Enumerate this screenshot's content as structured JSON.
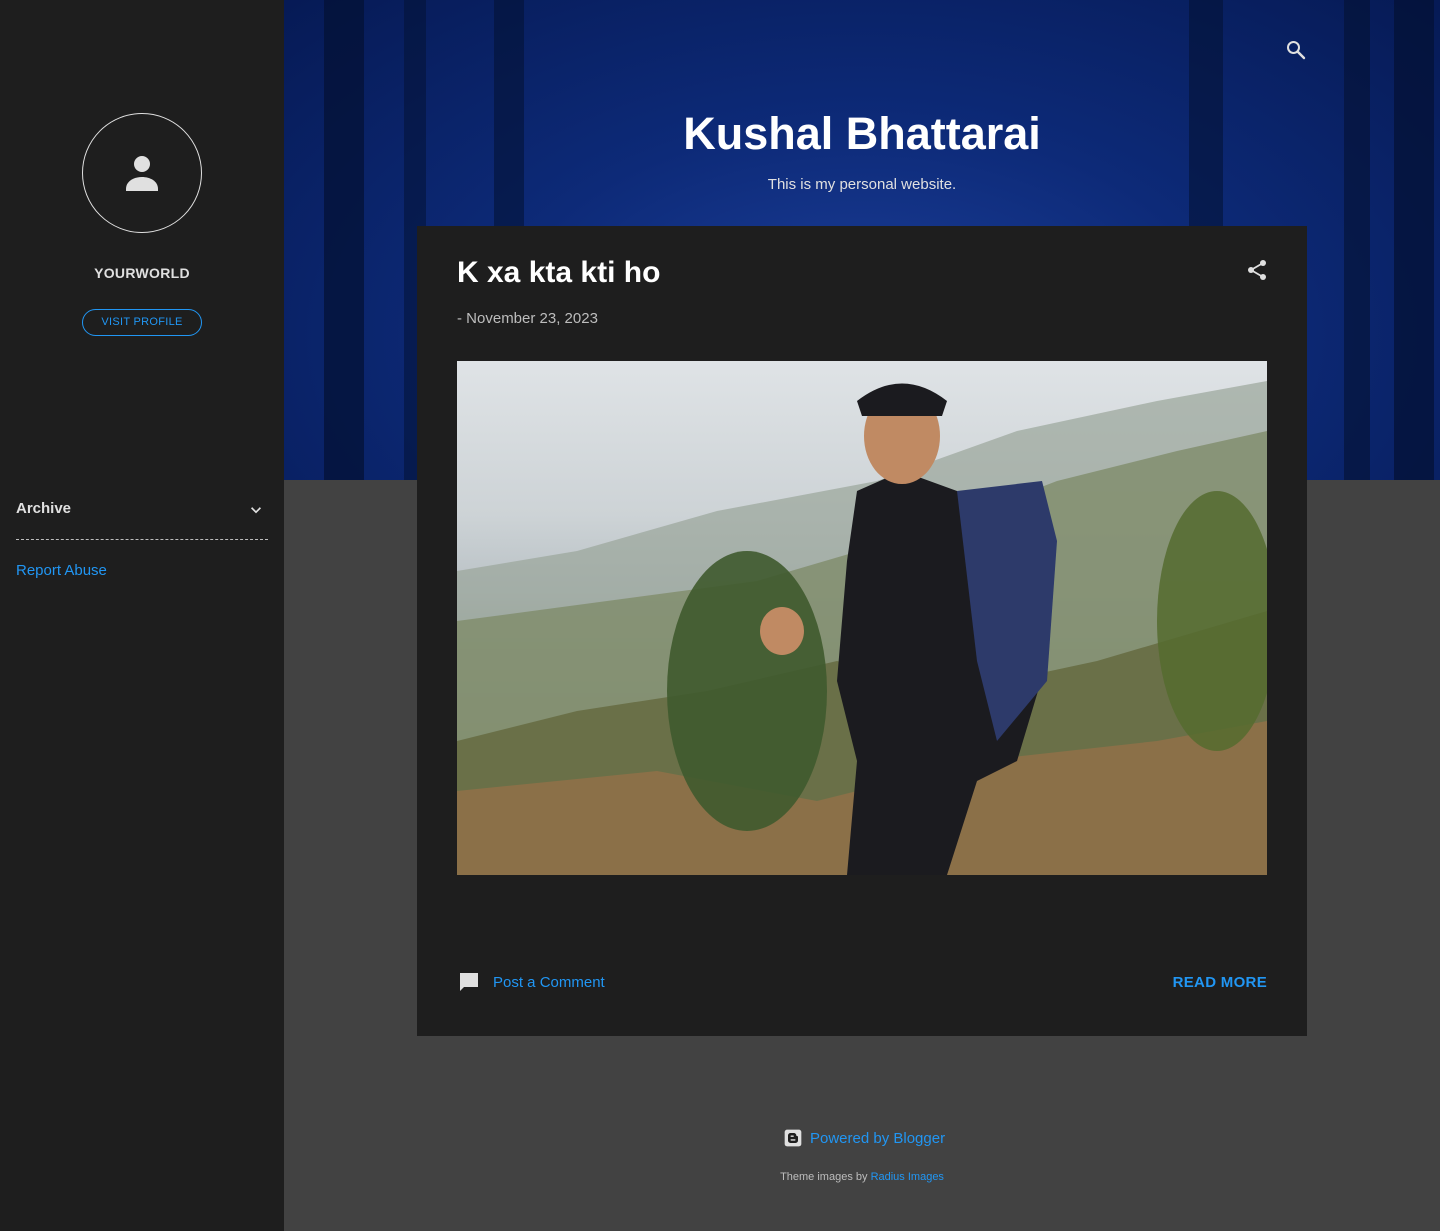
{
  "sidebar": {
    "profile_name": "YOURWORLD",
    "visit_profile_label": "VISIT PROFILE",
    "archive_label": "Archive",
    "report_abuse_label": "Report Abuse"
  },
  "header": {
    "blog_title": "Kushal Bhattarai",
    "blog_description": "This is my personal website."
  },
  "post": {
    "title": "K xa kta kti ho",
    "date_prefix": "-",
    "date": "November 23, 2023",
    "comment_label": "Post a Comment",
    "read_more_label": "READ MORE"
  },
  "footer": {
    "powered_by_label": "Powered by Blogger",
    "theme_credit_prefix": "Theme images by",
    "theme_credit_link": "Radius Images"
  },
  "icons": {
    "avatar": "person-icon",
    "archive_toggle": "chevron-down-icon",
    "search": "search-icon",
    "share": "share-icon",
    "comment": "comment-icon",
    "blogger": "blogger-icon"
  },
  "colors": {
    "page_background": "#424242",
    "sidebar_background": "#1e1e1e",
    "post_background": "#1e1e1e",
    "accent": "#2196f3",
    "header_blue": "#0d2a78"
  }
}
